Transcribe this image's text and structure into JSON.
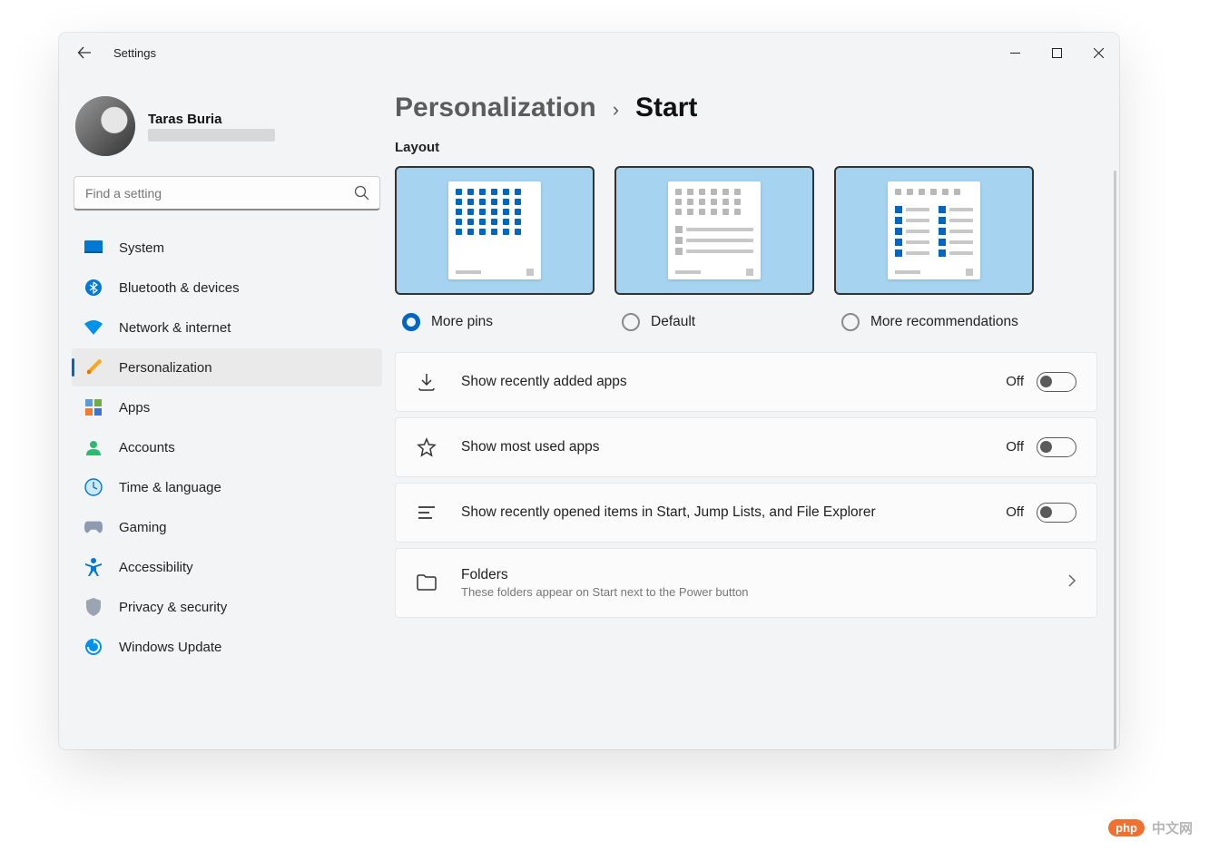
{
  "app": {
    "title": "Settings"
  },
  "profile": {
    "name": "Taras Buria"
  },
  "search": {
    "placeholder": "Find a setting"
  },
  "nav": {
    "items": [
      {
        "label": "System"
      },
      {
        "label": "Bluetooth & devices"
      },
      {
        "label": "Network & internet"
      },
      {
        "label": "Personalization"
      },
      {
        "label": "Apps"
      },
      {
        "label": "Accounts"
      },
      {
        "label": "Time & language"
      },
      {
        "label": "Gaming"
      },
      {
        "label": "Accessibility"
      },
      {
        "label": "Privacy & security"
      },
      {
        "label": "Windows Update"
      }
    ]
  },
  "breadcrumb": {
    "parent": "Personalization",
    "separator": "›",
    "current": "Start"
  },
  "layout": {
    "section_label": "Layout",
    "options": [
      {
        "label": "More pins",
        "checked": true
      },
      {
        "label": "Default",
        "checked": false
      },
      {
        "label": "More recommendations",
        "checked": false
      }
    ]
  },
  "settings": [
    {
      "title": "Show recently added apps",
      "state": "Off"
    },
    {
      "title": "Show most used apps",
      "state": "Off"
    },
    {
      "title": "Show recently opened items in Start, Jump Lists, and File Explorer",
      "state": "Off"
    }
  ],
  "folders_row": {
    "title": "Folders",
    "desc": "These folders appear on Start next to the Power button"
  },
  "watermark": {
    "logo": "php",
    "text": "中文网"
  }
}
